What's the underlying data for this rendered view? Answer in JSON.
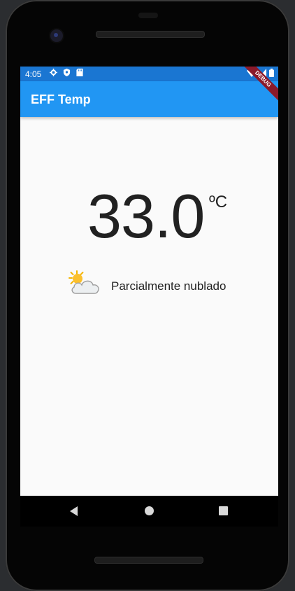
{
  "status_bar": {
    "time": "4:05"
  },
  "app_bar": {
    "title": "EFF Temp",
    "debug_label": "DEBUG"
  },
  "weather": {
    "temperature": "33.0",
    "unit": "ºC",
    "condition": "Parcialmente nublado",
    "condition_icon": "partly-cloudy-icon"
  },
  "navigation": {
    "back_icon": "back-triangle-icon",
    "home_icon": "home-circle-icon",
    "recents_icon": "recents-square-icon"
  },
  "colors": {
    "app_bar": "#2196f3",
    "status_bar": "#1a76d2",
    "screen_bg": "#fafafa",
    "text": "#212121"
  }
}
